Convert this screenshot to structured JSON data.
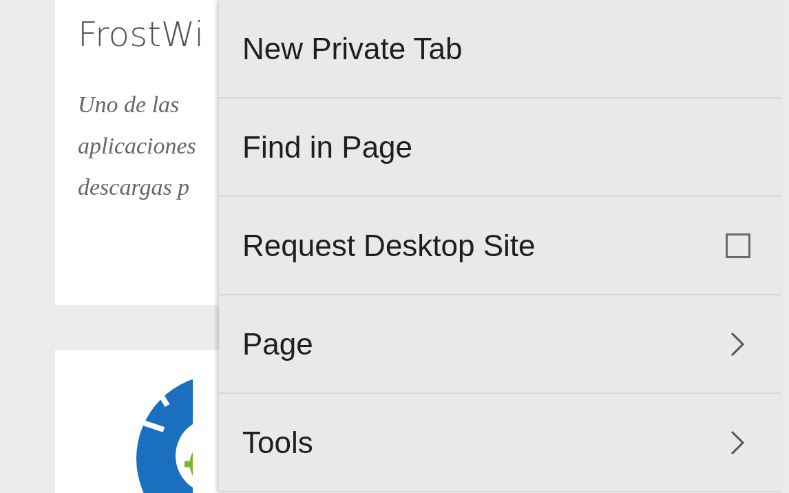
{
  "card": {
    "title": "FrostWi",
    "description": "Uno de las aplicaciones descargas p"
  },
  "menu": {
    "items": [
      {
        "label": "New Private Tab",
        "kind": "plain"
      },
      {
        "label": "Find in Page",
        "kind": "plain"
      },
      {
        "label": "Request Desktop Site",
        "kind": "checkbox",
        "checked": false
      },
      {
        "label": "Page",
        "kind": "submenu"
      },
      {
        "label": "Tools",
        "kind": "submenu"
      }
    ]
  }
}
